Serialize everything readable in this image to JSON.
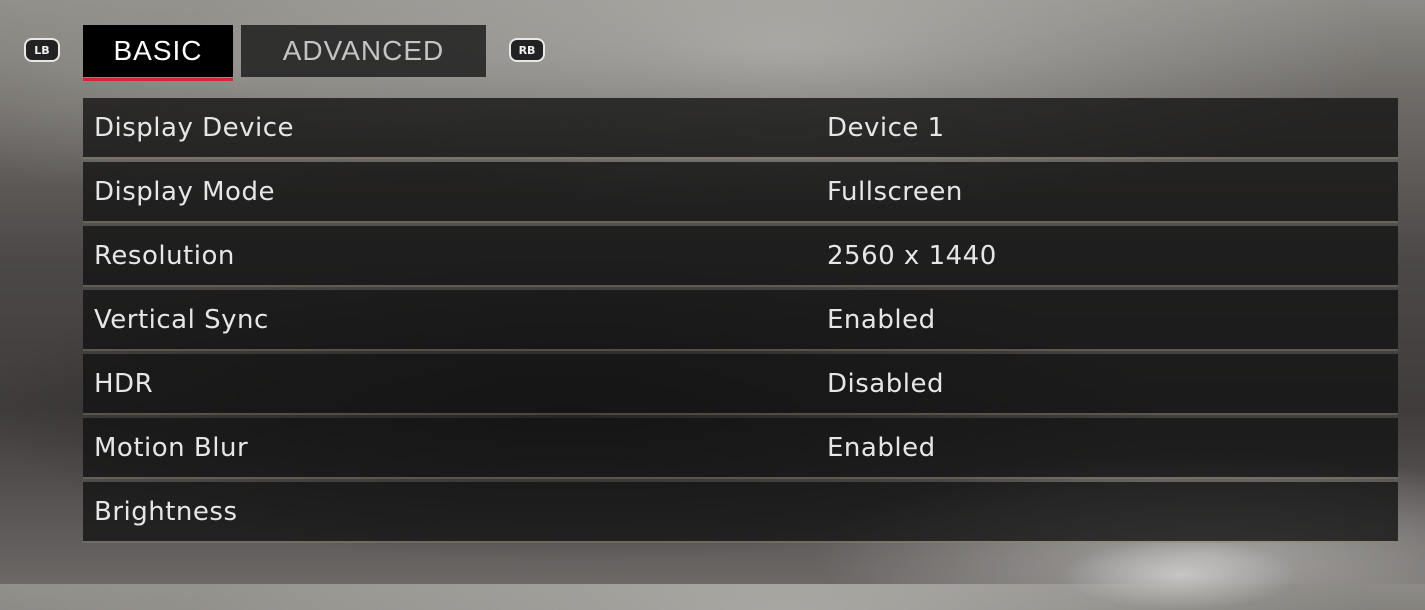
{
  "tabs": {
    "left_bumper": "LB",
    "right_bumper": "RB",
    "items": [
      {
        "label": "BASIC",
        "active": true
      },
      {
        "label": "ADVANCED",
        "active": false
      }
    ]
  },
  "settings": [
    {
      "label": "Display Device",
      "value": "Device 1"
    },
    {
      "label": "Display Mode",
      "value": "Fullscreen"
    },
    {
      "label": "Resolution",
      "value": "2560 x 1440"
    },
    {
      "label": "Vertical Sync",
      "value": "Enabled"
    },
    {
      "label": "HDR",
      "value": "Disabled"
    },
    {
      "label": "Motion Blur",
      "value": "Enabled"
    },
    {
      "label": "Brightness",
      "value": ""
    }
  ],
  "colors": {
    "active_tab_underline": "#d7262b",
    "text": "#e6e6e6"
  }
}
